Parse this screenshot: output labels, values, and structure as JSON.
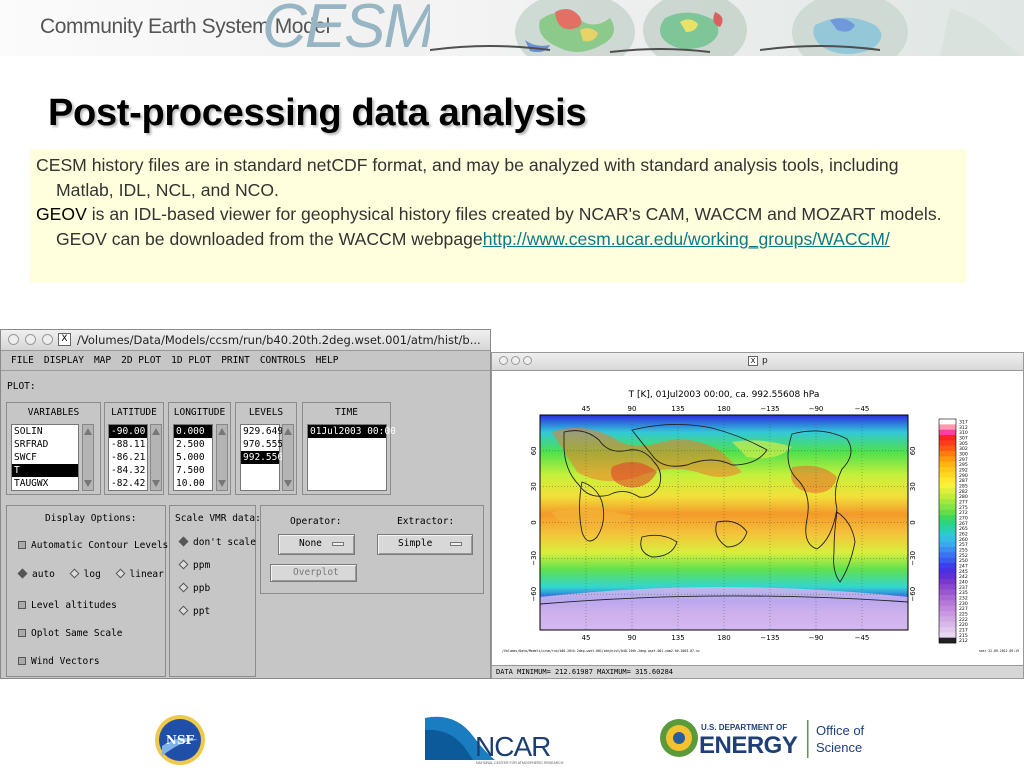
{
  "banner": {
    "title": "Community Earth System Model",
    "logo_text": "CESM"
  },
  "slide": {
    "title": "Post-processing data analysis"
  },
  "textbox": {
    "para1": "CESM history files are in standard netCDF format, and may be analyzed with standard analysis tools, including Matlab, IDL, NCL, and NCO.",
    "geov_term": "GEOV",
    "para2_rest": " is an IDL-based viewer for geophysical history files created by NCAR's CAM, WACCM and MOZART models. GEOV can be downloaded from the WACCM webpage",
    "link": "http://www.cesm.ucar.edu/working_groups/WACCM/"
  },
  "geov_window": {
    "title": "/Volumes/Data/Models/ccsm/run/b40.20th.2deg.wset.001/atm/hist/b...",
    "menu": [
      "FILE",
      "DISPLAY",
      "MAP",
      "2D PLOT",
      "1D PLOT",
      "PRINT",
      "CONTROLS",
      "HELP"
    ],
    "plot_label": "PLOT:",
    "columns": {
      "variables": {
        "label": "VARIABLES",
        "items": [
          "SOLIN",
          "SRFRAD",
          "SWCF",
          "T",
          "TAUGWX"
        ],
        "selected": 3
      },
      "latitude": {
        "label": "LATITUDE",
        "items": [
          "-90.00",
          "-88.11",
          "-86.21",
          "-84.32",
          "-82.42"
        ],
        "selected": 0
      },
      "longitude": {
        "label": "LONGITUDE",
        "items": [
          "0.000",
          "2.500",
          "5.000",
          "7.500",
          "10.00"
        ],
        "selected": 0
      },
      "levels": {
        "label": "LEVELS",
        "items": [
          "929.649",
          "970.555",
          "992.556"
        ],
        "selected": 2
      },
      "time": {
        "label": "TIME",
        "items": [
          "01Jul2003 00:00"
        ],
        "selected": 0
      }
    },
    "display_options": {
      "label": "Display Options:",
      "auto_contour": "Automatic Contour Levels",
      "radio": [
        "auto",
        "log",
        "linear"
      ],
      "radio_selected": 0,
      "level_altitudes": "Level altitudes",
      "oplot_same_scale": "Oplot Same Scale",
      "wind_vectors": "Wind Vectors"
    },
    "scale_vmr": {
      "label": "Scale VMR data:",
      "options": [
        "don't scale",
        "ppm",
        "ppb",
        "ppt"
      ],
      "selected": 0
    },
    "operator": {
      "label": "Operator:",
      "value": "None"
    },
    "extractor": {
      "label": "Extractor:",
      "value": "Simple"
    },
    "overplot_button": "Overplot"
  },
  "plot_window": {
    "title": "p",
    "status": "DATA MINIMUM=      212.61987 MAXIMUM=       315.60284",
    "footer_path": "/Volumes/Data/Models/ccsm/run/b40.20th.2deg.wset.001/atm/hist/b40.20th.2deg.wset.001.cam2.h0.2003-07.nc",
    "footer_date": "ncar 22.09.2012 09:19"
  },
  "chart_data": {
    "type": "heatmap",
    "title": "T [K], 01Jul2003 00:00, ca. 992.55608 hPa",
    "x_ticks": [
      "45",
      "90",
      "135",
      "180",
      "−135",
      "−90",
      "−45"
    ],
    "y_ticks": [
      "60",
      "30",
      "0",
      "−30",
      "−60"
    ],
    "colorbar_ticks": [
      "317",
      "312",
      "310",
      "307",
      "305",
      "302",
      "300",
      "297",
      "295",
      "292",
      "290",
      "287",
      "285",
      "282",
      "280",
      "277",
      "275",
      "272",
      "270",
      "267",
      "265",
      "262",
      "260",
      "257",
      "255",
      "252",
      "250",
      "247",
      "245",
      "242",
      "240",
      "237",
      "235",
      "232",
      "230",
      "227",
      "225",
      "222",
      "220",
      "217",
      "215",
      "212"
    ],
    "min": 212.61987,
    "max": 315.60284
  },
  "logos": {
    "nsf": "NSF",
    "ncar": "NCAR",
    "ncar_sub": "NATIONAL CENTER FOR ATMOSPHERIC RESEARCH",
    "doe_small": "U.S. DEPARTMENT OF",
    "doe_big": "ENERGY",
    "office1": "Office of",
    "office2": "Science"
  }
}
